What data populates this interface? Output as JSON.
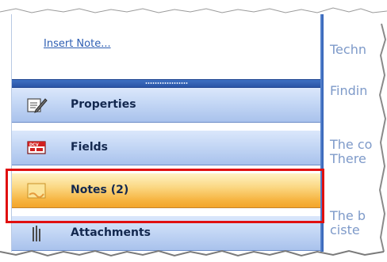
{
  "notes_panel": {
    "insert_note_link": "Insert Note..."
  },
  "nav": {
    "items": [
      {
        "label": "Properties",
        "icon": "properties-icon"
      },
      {
        "label": "Fields",
        "icon": "fields-icon"
      },
      {
        "label": "Notes (2)",
        "icon": "notes-icon",
        "selected": true
      },
      {
        "label": "Attachments",
        "icon": "attachments-icon"
      }
    ]
  },
  "right_pane": {
    "lines": [
      "Techn",
      "Findin",
      "The co",
      "There",
      "The b",
      "ciste"
    ]
  },
  "colors": {
    "link": "#2f5fb3",
    "nav_gradient_top": "#dbe7fb",
    "nav_gradient_bottom": "#a9c2ec",
    "selected_gradient_top": "#fff2c3",
    "selected_gradient_bottom": "#f3a52a",
    "highlight": "#e01010",
    "splitter": "#2a55a6"
  }
}
